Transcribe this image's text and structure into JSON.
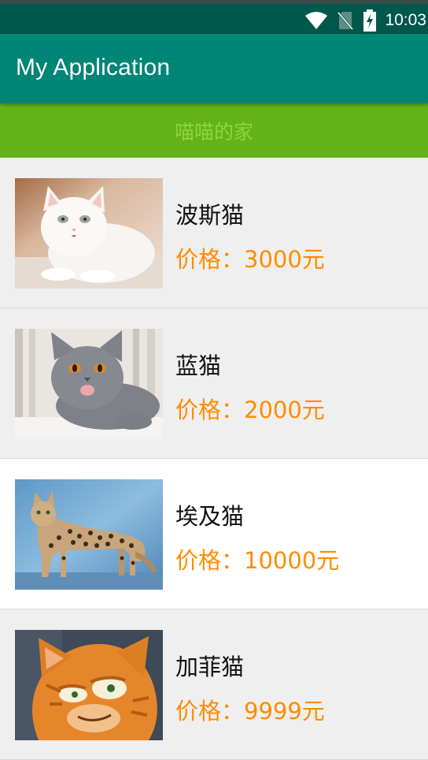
{
  "status_bar": {
    "time": "10:03",
    "icons": [
      "wifi-icon",
      "no-sim-icon",
      "battery-charging-icon"
    ]
  },
  "app_bar": {
    "title": "My Application"
  },
  "banner": {
    "text": "喵喵的家"
  },
  "cats": [
    {
      "name": "波斯猫",
      "price": "价格：3000元",
      "image": "white-persian-cat"
    },
    {
      "name": "蓝猫",
      "price": "价格：2000元",
      "image": "gray-blue-cat"
    },
    {
      "name": "埃及猫",
      "price": "价格：10000元",
      "image": "spotted-egyptian-cat"
    },
    {
      "name": "加菲猫",
      "price": "价格：9999元",
      "image": "orange-garfield-cat"
    }
  ],
  "colors": {
    "status_bar": "#00574b",
    "app_bar": "#008577",
    "banner_bg": "#62b31a",
    "banner_text": "#8fd43a",
    "price": "#ff8c00",
    "row_light": "#efefef",
    "row_white": "#ffffff"
  }
}
